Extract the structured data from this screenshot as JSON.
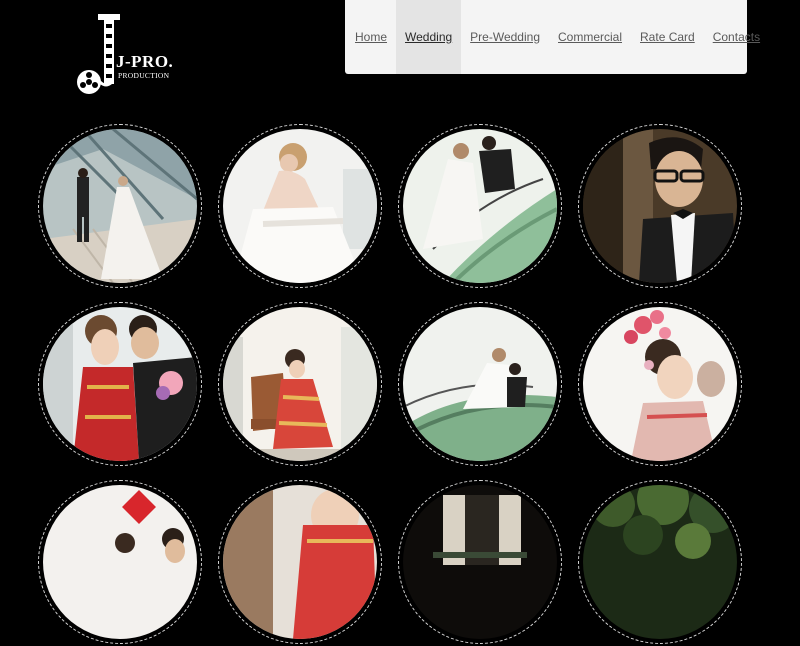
{
  "logo": {
    "brand": "J-PRO.",
    "subtitle": "PRODUCTION",
    "icon": "film-reel-j-icon"
  },
  "nav": {
    "items": [
      {
        "label": "Home",
        "active": false
      },
      {
        "label": "Wedding",
        "active": true
      },
      {
        "label": "Pre-Wedding",
        "active": false
      },
      {
        "label": "Commercial",
        "active": false
      },
      {
        "label": "Rate Card",
        "active": false
      },
      {
        "label": "Contacts",
        "active": false
      }
    ]
  },
  "gallery": {
    "photos": [
      {
        "scene": "bride-groom-stairs-white"
      },
      {
        "scene": "bride-white-gown-seated"
      },
      {
        "scene": "couple-glass-staircase"
      },
      {
        "scene": "groom-tuxedo-glasses"
      },
      {
        "scene": "couple-red-qipao-flower"
      },
      {
        "scene": "bride-qipao-chair"
      },
      {
        "scene": "couple-glass-staircase-wide"
      },
      {
        "scene": "bride-qipao-floral-headpiece"
      },
      {
        "scene": "couple-red-decoration"
      },
      {
        "scene": "bride-qipao-closeup"
      },
      {
        "scene": "dark-doorway"
      },
      {
        "scene": "green-foliage-night"
      }
    ]
  },
  "colors": {
    "background": "#000000",
    "nav_bg": "#f4f4f4",
    "nav_active_bg": "#e4e4e4",
    "nav_text": "#5a5a5a"
  }
}
